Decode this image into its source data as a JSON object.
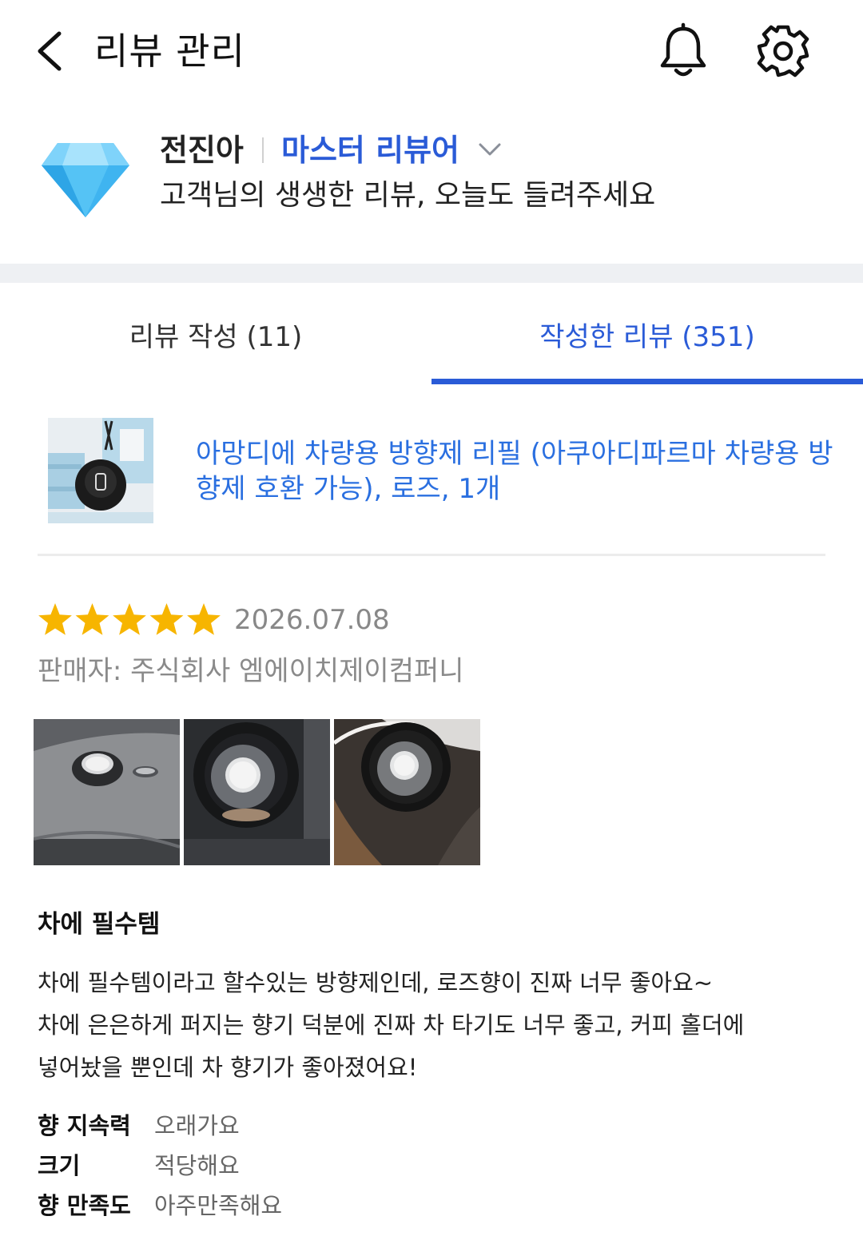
{
  "header": {
    "title": "리뷰 관리",
    "back_icon": "chevron-left-icon",
    "notifications_icon": "bell-icon",
    "settings_icon": "gear-icon"
  },
  "profile": {
    "name": "전진아",
    "grade": "마스터 리뷰어",
    "greeting": "고객님의 생생한 리뷰, 오늘도 들려주세요",
    "badge_icon": "diamond-icon"
  },
  "tabs": [
    {
      "label": "리뷰 작성 (11)",
      "active": false
    },
    {
      "label": "작성한 리뷰 (351)",
      "active": true
    }
  ],
  "review": {
    "product_title": "아망디에 차량용 방향제 리필 (아쿠아디파르마 차량용 방향제 호환 가능), 로즈, 1개",
    "rating": 5,
    "rating_max": 5,
    "date": "2026.07.08",
    "seller": "판매자: 주식회사 엠에이치제이컴퍼니",
    "photo_count": 3,
    "headline": "차에 필수템",
    "body_lines": [
      "차에 필수템이라고 할수있는 방향제인데, 로즈향이 진짜 너무 좋아요~",
      "차에 은은하게 퍼지는 향기 덕분에 진짜 차 타기도 너무 좋고,  커피 홀더에",
      "넣어놨을 뿐인데 차 향기가 좋아졌어요!"
    ],
    "attributes": [
      {
        "label": "향 지속력",
        "value": "오래가요"
      },
      {
        "label": "크기",
        "value": "적당해요"
      },
      {
        "label": "향 만족도",
        "value": "아주만족해요"
      }
    ]
  },
  "colors": {
    "accent": "#2a5bd7",
    "link": "#2a6fe0",
    "star": "#f7b500",
    "muted": "#888888",
    "divider_band": "#eef0f3"
  }
}
